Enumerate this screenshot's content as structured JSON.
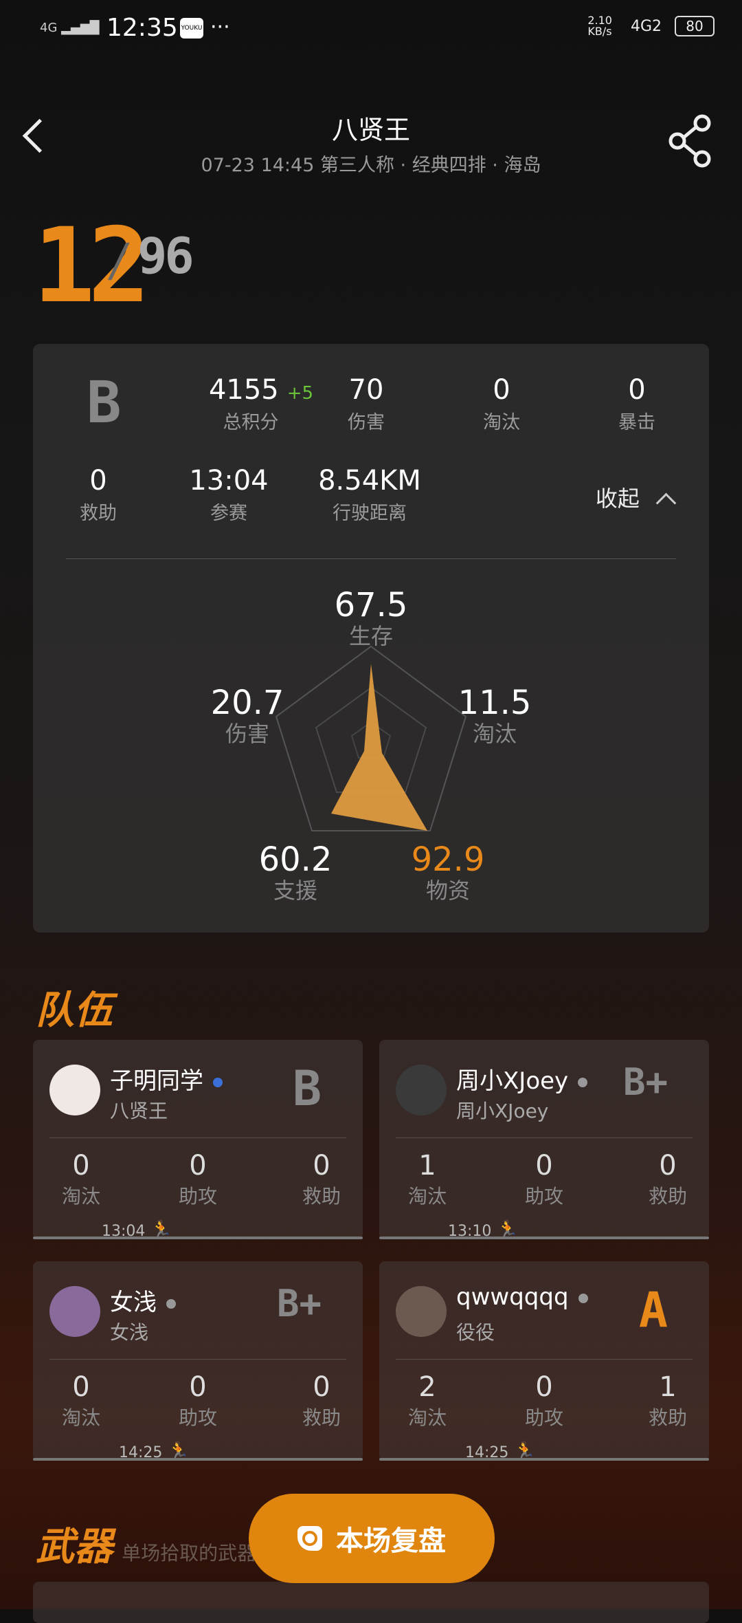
{
  "status_bar": {
    "signal": "4G",
    "time": "12:35",
    "app_icon": "YOUKU",
    "more": "···",
    "speed": "2.10\nKB/s",
    "network": "4G2",
    "battery": "80"
  },
  "header": {
    "title": "八贤王",
    "subtitle": "07-23 14:45 第三人称 · 经典四排 · 海岛"
  },
  "rank": {
    "place": "12",
    "separator": "/",
    "total": "96"
  },
  "summary": {
    "grade": "B",
    "score": {
      "value": "4155",
      "delta": "+5",
      "label": "总积分"
    },
    "damage": {
      "value": "70",
      "label": "伤害"
    },
    "kills": {
      "value": "0",
      "label": "淘汰"
    },
    "crits": {
      "value": "0",
      "label": "暴击"
    },
    "revives": {
      "value": "0",
      "label": "救助"
    },
    "time": {
      "value": "13:04",
      "label": "参赛"
    },
    "drive": {
      "value": "8.54KM",
      "label": "行驶距离"
    },
    "collapse_label": "收起",
    "radar": {
      "survival": {
        "value": "67.5",
        "label": "生存"
      },
      "kill": {
        "value": "11.5",
        "label": "淘汰"
      },
      "supply": {
        "value": "92.9",
        "label": "物资"
      },
      "support": {
        "value": "60.2",
        "label": "支援"
      },
      "damage": {
        "value": "20.7",
        "label": "伤害"
      }
    }
  },
  "team": {
    "title": "队伍",
    "members": [
      {
        "name": "子明同学",
        "id": "八贤王",
        "grade": "B",
        "kills": "0",
        "assists": "0",
        "revives": "0",
        "kills_label": "淘汰",
        "assists_label": "助攻",
        "revives_label": "救助",
        "time": "13:04",
        "dot_color": "#3a6fd8"
      },
      {
        "name": "周小XJoey",
        "id": "周小XJoey",
        "grade": "B+",
        "kills": "1",
        "assists": "0",
        "revives": "0",
        "kills_label": "淘汰",
        "assists_label": "助攻",
        "revives_label": "救助",
        "time": "13:10",
        "dot_color": "#999999"
      },
      {
        "name": "女浅",
        "id": "女浅",
        "grade": "B+",
        "kills": "0",
        "assists": "0",
        "revives": "0",
        "kills_label": "淘汰",
        "assists_label": "助攻",
        "revives_label": "救助",
        "time": "14:25",
        "dot_color": "#999999"
      },
      {
        "name": "qwwqqqq",
        "id": "役役",
        "grade": "A",
        "kills": "2",
        "assists": "0",
        "revives": "1",
        "kills_label": "淘汰",
        "assists_label": "助攻",
        "revives_label": "救助",
        "time": "14:25",
        "dot_color": "#999999"
      }
    ]
  },
  "weapons": {
    "title": "武器",
    "subtitle": "单场拾取的武器"
  },
  "replay_button": {
    "label": "本场复盘"
  },
  "colors": {
    "accent": "#e8891a",
    "positive": "#6bc33a"
  }
}
